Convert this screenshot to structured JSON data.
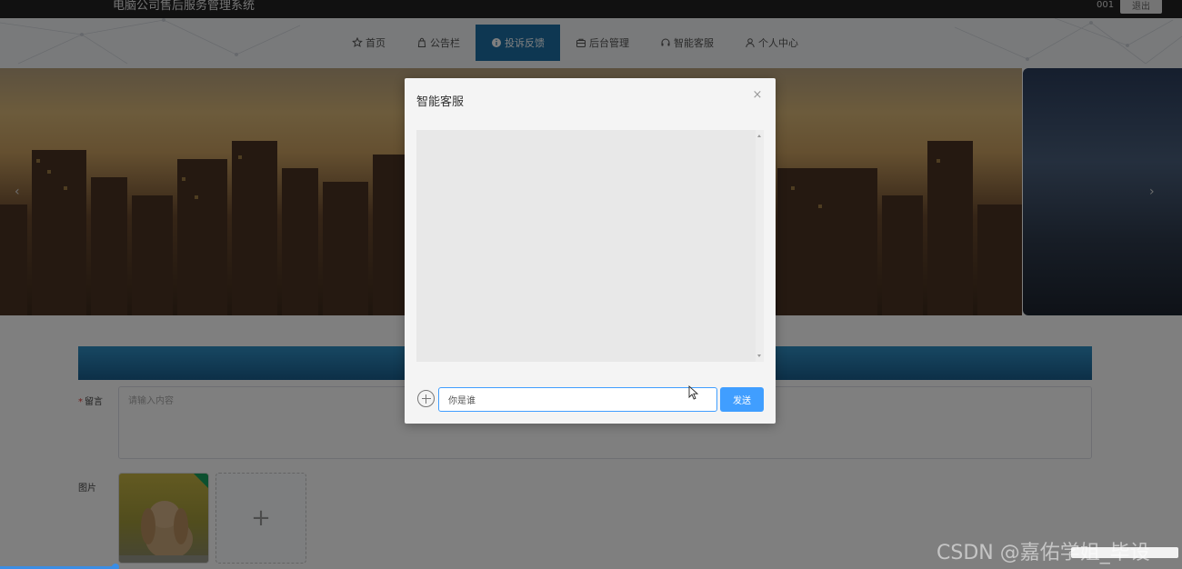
{
  "topbar": {
    "site_title": "电脑公司售后服务管理系统",
    "user_id": "001",
    "logout_label": "退出"
  },
  "nav": {
    "items": [
      {
        "label": "首页",
        "icon": "star-icon",
        "active": false
      },
      {
        "label": "公告栏",
        "icon": "bag-icon",
        "active": false
      },
      {
        "label": "投诉反馈",
        "icon": "info-circle-icon",
        "active": true
      },
      {
        "label": "后台管理",
        "icon": "briefcase-icon",
        "active": false
      },
      {
        "label": "智能客服",
        "icon": "headset-icon",
        "active": false
      },
      {
        "label": "个人中心",
        "icon": "user-icon",
        "active": false
      }
    ],
    "active_color": "#1d6fa5"
  },
  "form": {
    "message_label": "留言",
    "message_placeholder": "请输入内容",
    "image_label": "图片",
    "upload_symbol": "+"
  },
  "dialog": {
    "title": "智能客服",
    "input_value": "你是谁",
    "send_label": "发送",
    "accent_color": "#409eff"
  },
  "watermark": "CSDN @嘉佑学姐_毕设"
}
